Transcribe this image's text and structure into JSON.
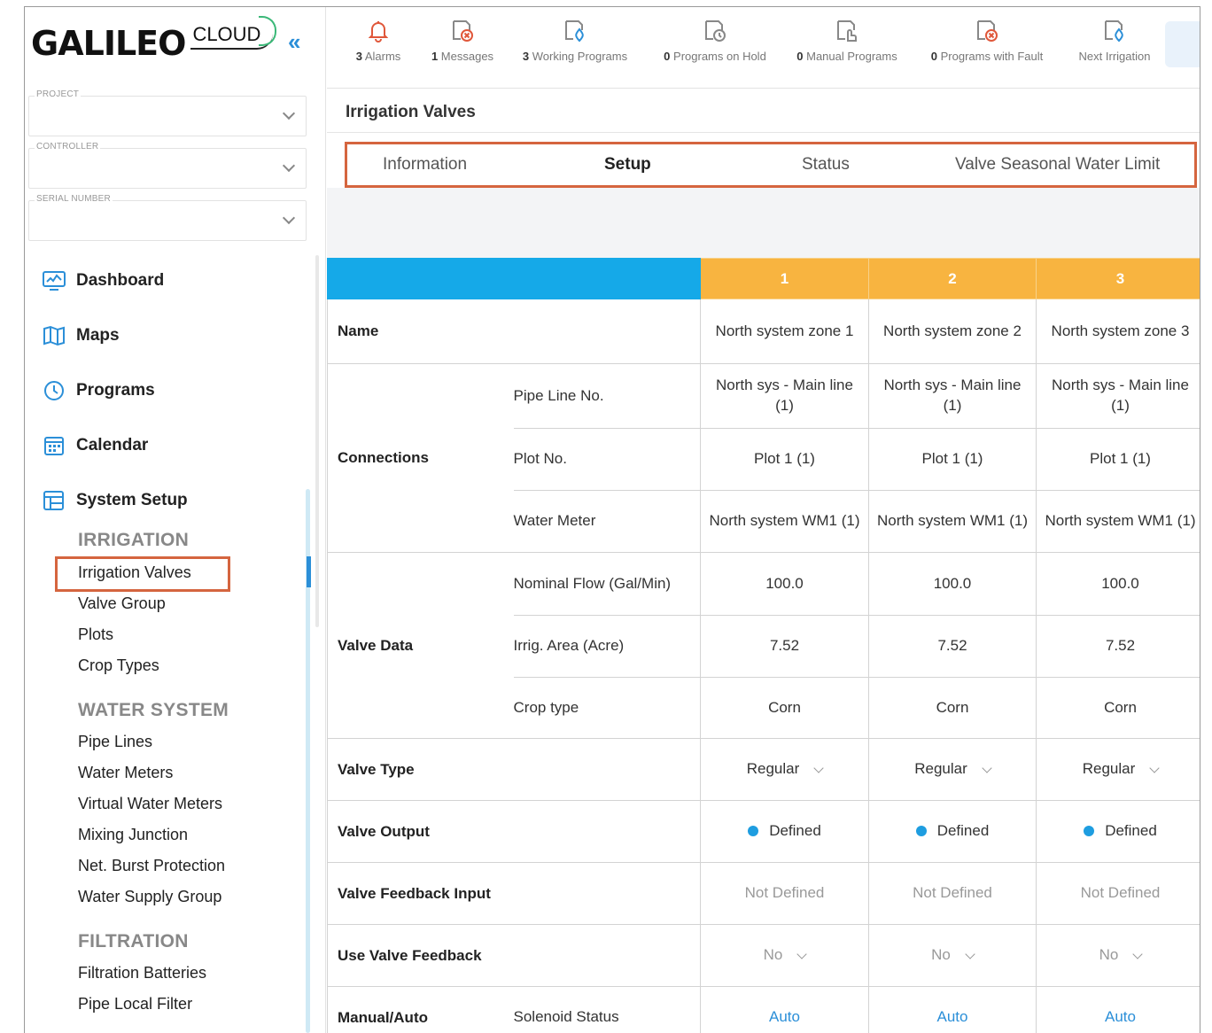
{
  "brand": {
    "name": "GALILEO",
    "cloud": "CLOUD",
    "collapse": "«"
  },
  "filters": [
    {
      "label": "PROJECT",
      "value": ""
    },
    {
      "label": "CONTROLLER",
      "value": ""
    },
    {
      "label": "SERIAL NUMBER",
      "value": ""
    }
  ],
  "nav": [
    {
      "label": "Dashboard",
      "icon": "dashboard-icon"
    },
    {
      "label": "Maps",
      "icon": "map-icon"
    },
    {
      "label": "Programs",
      "icon": "clock-icon"
    },
    {
      "label": "Calendar",
      "icon": "calendar-icon"
    },
    {
      "label": "System Setup",
      "icon": "table-icon"
    }
  ],
  "sections": {
    "irrigation": {
      "title": "IRRIGATION",
      "items": [
        "Irrigation Valves",
        "Valve Group",
        "Plots",
        "Crop Types"
      ]
    },
    "water": {
      "title": "WATER SYSTEM",
      "items": [
        "Pipe Lines",
        "Water Meters",
        "Virtual Water Meters",
        "Mixing Junction",
        "Net. Burst Protection",
        "Water Supply Group"
      ]
    },
    "filtration": {
      "title": "FILTRATION",
      "items": [
        "Filtration Batteries",
        "Pipe Local Filter"
      ]
    }
  },
  "toolbar": [
    {
      "count": "3",
      "label": "Alarms",
      "icon": "bell-icon"
    },
    {
      "count": "1",
      "label": "Messages",
      "icon": "message-error-icon"
    },
    {
      "count": "3",
      "label": "Working Programs",
      "icon": "working-program-icon"
    },
    {
      "count": "0",
      "label": "Programs on Hold",
      "icon": "hold-program-icon"
    },
    {
      "count": "0",
      "label": "Manual Programs",
      "icon": "manual-program-icon"
    },
    {
      "count": "0",
      "label": "Programs with Fault",
      "icon": "fault-program-icon"
    },
    {
      "count": "",
      "label": "Next Irrigation",
      "icon": "next-irrigation-icon"
    }
  ],
  "page": {
    "title": "Irrigation Valves"
  },
  "tabs": [
    "Information",
    "Setup",
    "Status",
    "Valve Seasonal Water Limit"
  ],
  "table": {
    "columns": [
      "1",
      "2",
      "3"
    ],
    "name": {
      "label": "Name",
      "values": [
        "North system zone 1",
        "North system zone 2",
        "North system zone 3"
      ]
    },
    "connections": {
      "label": "Connections",
      "rows": [
        {
          "label": "Pipe Line No.",
          "values": [
            "North sys - Main line (1)",
            "North sys - Main line (1)",
            "North sys - Main line (1)"
          ]
        },
        {
          "label": "Plot No.",
          "values": [
            "Plot 1 (1)",
            "Plot 1 (1)",
            "Plot 1 (1)"
          ]
        },
        {
          "label": "Water Meter",
          "values": [
            "North system WM1 (1)",
            "North system WM1 (1)",
            "North system WM1 (1)"
          ]
        }
      ]
    },
    "valve_data": {
      "label": "Valve Data",
      "rows": [
        {
          "label": "Nominal Flow (Gal/Min)",
          "values": [
            "100.0",
            "100.0",
            "100.0"
          ]
        },
        {
          "label": "Irrig. Area (Acre)",
          "values": [
            "7.52",
            "7.52",
            "7.52"
          ]
        },
        {
          "label": "Crop type",
          "values": [
            "Corn",
            "Corn",
            "Corn"
          ]
        }
      ]
    },
    "valve_type": {
      "label": "Valve Type",
      "values": [
        "Regular",
        "Regular",
        "Regular"
      ]
    },
    "valve_output": {
      "label": "Valve Output",
      "values": [
        "Defined",
        "Defined",
        "Defined"
      ]
    },
    "valve_feedback_input": {
      "label": "Valve Feedback Input",
      "values": [
        "Not Defined",
        "Not Defined",
        "Not Defined"
      ]
    },
    "use_valve_feedback": {
      "label": "Use Valve Feedback",
      "values": [
        "No",
        "No",
        "No"
      ]
    },
    "manual_auto": {
      "label": "Manual/Auto",
      "sub": "Solenoid Status",
      "values": [
        "Auto",
        "Auto",
        "Auto"
      ]
    }
  },
  "colors": {
    "accent": "#15a9e8",
    "column_header": "#f8b440",
    "highlight": "#d5653f",
    "link": "#2b8fd8"
  }
}
